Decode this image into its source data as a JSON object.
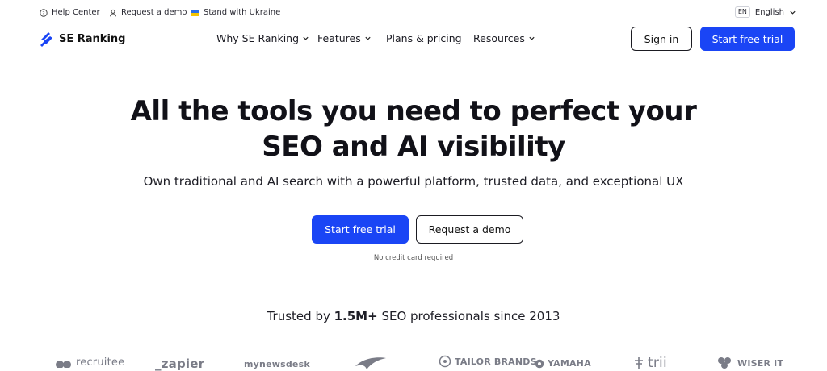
{
  "topbar": {
    "help_label": "Help Center",
    "demo_label": "Request a demo",
    "ukraine_label": "Stand with Ukraine",
    "lang_code": "EN",
    "lang_label": "English"
  },
  "nav": {
    "logo_text": "SE Ranking",
    "items": [
      "Why SE Ranking",
      "Features",
      "Plans & pricing",
      "Resources"
    ],
    "sign_in": "Sign in",
    "cta": "Start free trial"
  },
  "hero": {
    "title_line1": "All the tools you need to perfect your",
    "title_line2": "SEO and AI visibility",
    "subtitle": "Own traditional and AI search with a powerful platform, trusted data, and exceptional UX",
    "primary_cta": "Start free trial",
    "secondary_cta": "Request a demo",
    "note": "No credit card required"
  },
  "trusted": {
    "prefix": "Trusted by ",
    "highlight": "1.5M+",
    "suffix": " SEO professionals since 2013"
  },
  "logos": [
    "recruitee",
    "_zapier",
    "mynewsdesk",
    "",
    "TAILOR BRANDS",
    "YAMAHA",
    "trii",
    "WISER IT"
  ],
  "colors": {
    "primary": "#1a45f5",
    "text": "#111118",
    "logo_gray": "#7a7c87"
  }
}
